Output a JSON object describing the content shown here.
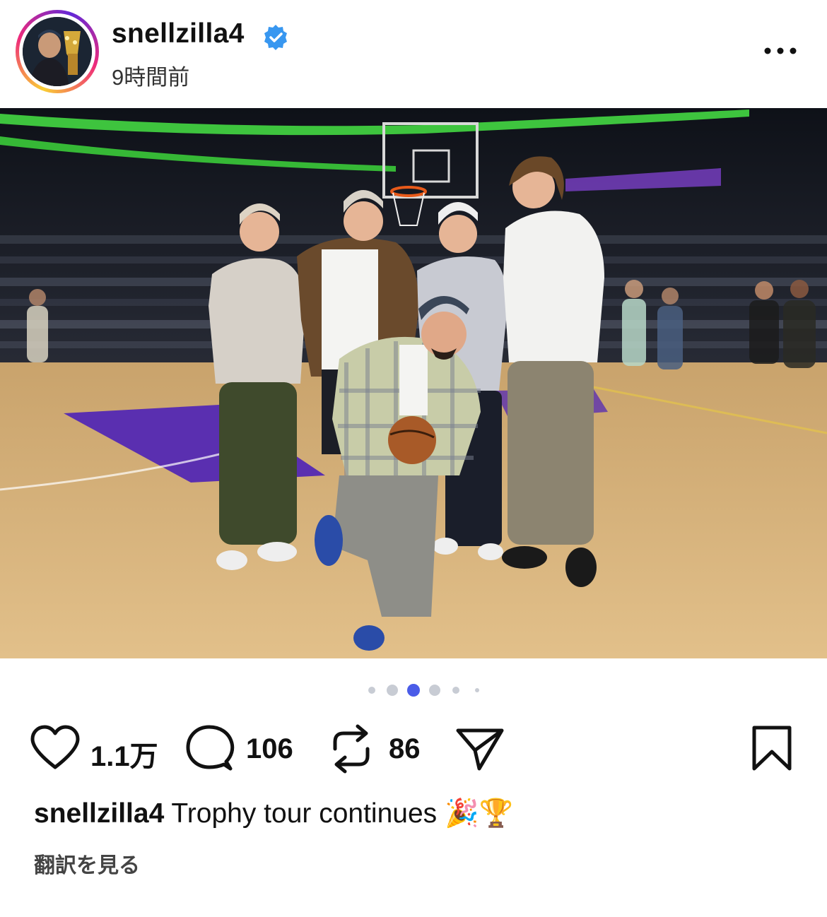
{
  "post": {
    "username": "snellzilla4",
    "time_ago": "9時間前",
    "verified": true,
    "avatar_icon": "profile-photo-with-trophy",
    "photo": {
      "description_icon": "group-photo-basketball-court",
      "carousel_total": 6,
      "carousel_active": 3
    },
    "actions": {
      "likes": "1.1万",
      "comments": "106",
      "reposts": "86"
    },
    "caption": {
      "username": "snellzilla4",
      "text": " Trophy tour continues ",
      "emojis": "🎉🏆"
    },
    "translate_label": "翻訳を見る"
  },
  "colors": {
    "verified": "#3897f0",
    "active_dot": "#4a5ce8",
    "inactive_dot": "#c8ccd4",
    "court_purple": "#5a2fb0",
    "arena_green": "#3ec43e"
  },
  "icons": [
    "heart-icon",
    "comment-icon",
    "repost-icon",
    "share-icon",
    "bookmark-icon",
    "more-icon",
    "verified-icon"
  ]
}
